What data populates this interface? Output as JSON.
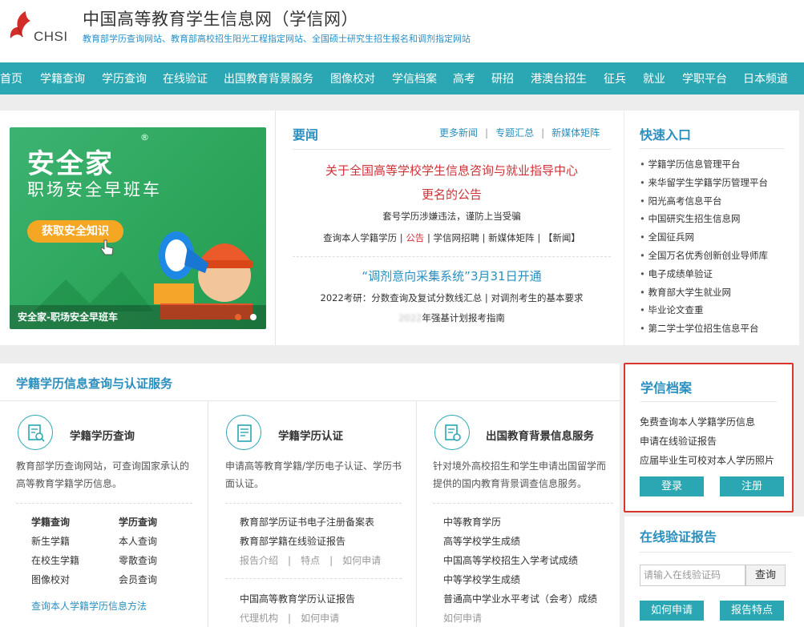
{
  "header": {
    "logo_text": "CHSI",
    "title": "中国高等教育学生信息网（学信网）",
    "subtitle": "教育部学历查询网站、教育部高校招生阳光工程指定网站、全国硕士研究生招生报名和调剂指定网站"
  },
  "nav": [
    "首页",
    "学籍查询",
    "学历查询",
    "在线验证",
    "出国教育背景服务",
    "图像校对",
    "学信档案",
    "高考",
    "研招",
    "港澳台招生",
    "征兵",
    "就业",
    "学职平台",
    "日本频道"
  ],
  "banner": {
    "title": "安全家",
    "reg_mark": "®",
    "subtitle": "职场安全早班车",
    "button": "获取安全知识",
    "caption": "安全家-职场安全早班车"
  },
  "news": {
    "heading": "要闻",
    "links": [
      "更多新闻",
      "专题汇总",
      "新媒体矩阵"
    ],
    "headline_1": "关于全国高等学校学生信息咨询与就业指导中心",
    "headline_2": "更名的公告",
    "line_1": "套号学历涉嫌违法，谨防上当受骗",
    "line_2": {
      "a": "查询本人学籍学历",
      "sep": " | ",
      "b": "公告",
      "c": " | 学信网招聘 | 新媒体矩阵 | 【新闻】"
    },
    "headline_3": "“调剂意向采集系统”3月31日开通",
    "line_3": "2022考研：分数查询及复试分数线汇总 | 对调剂考生的基本要求",
    "line_4_hidden": "2022",
    "line_4": "年强基计划报考指南"
  },
  "quick": {
    "title": "快速入口",
    "items": [
      "学籍学历信息管理平台",
      "来华留学生学籍学历管理平台",
      "阳光高考信息平台",
      "中国研究生招生信息网",
      "全国征兵网",
      "全国万名优秀创新创业导师库",
      "电子成绩单验证",
      "教育部大学生就业网",
      "毕业论文查重",
      "第二学士学位招生信息平台"
    ]
  },
  "services": {
    "title": "学籍学历信息查询与认证服务",
    "col1": {
      "title": "学籍学历查询",
      "desc": "教育部学历查询网站，可查询国家承认的高等教育学籍学历信息。",
      "grid": [
        [
          "学籍查询",
          "学历查询"
        ],
        [
          "新生学籍",
          "本人查询"
        ],
        [
          "在校生学籍",
          "零散查询"
        ],
        [
          "图像校对",
          "会员查询"
        ]
      ],
      "link": "查询本人学籍学历信息方法"
    },
    "col2": {
      "title": "学籍学历认证",
      "desc": "申请高等教育学籍/学历电子认证、学历书面认证。",
      "link1": "教育部学历证书电子注册备案表",
      "link2": "教育部学籍在线验证报告",
      "sub1": [
        "报告介绍",
        "特点",
        "如何申请"
      ],
      "link3": "中国高等教育学历认证报告",
      "sub2": [
        "代理机构",
        "如何申请"
      ]
    },
    "col3": {
      "title": "出国教育背景信息服务",
      "desc": "针对境外高校招生和学生申请出国留学而提供的国内教育背景调查信息服务。",
      "items": [
        "中等教育学历",
        "高等学校学生成绩",
        "中国高等学校招生入学考试成绩",
        "中等学校学生成绩",
        "普通高中学业水平考试（会考）成绩",
        "如何申请"
      ]
    }
  },
  "archive": {
    "title": "学信档案",
    "lines": [
      "免费查询本人学籍学历信息",
      "申请在线验证报告",
      "应届毕业生可校对本人学历照片"
    ],
    "login": "登录",
    "register": "注册"
  },
  "verify": {
    "title": "在线验证报告",
    "placeholder": "请输入在线验证码",
    "search": "查询",
    "btn1": "如何申请",
    "btn2": "报告特点"
  },
  "colors": {
    "teal": "#2aa7b3",
    "blue": "#2a8fbe",
    "red": "#d0323a",
    "highlight_border": "#d9362b"
  }
}
